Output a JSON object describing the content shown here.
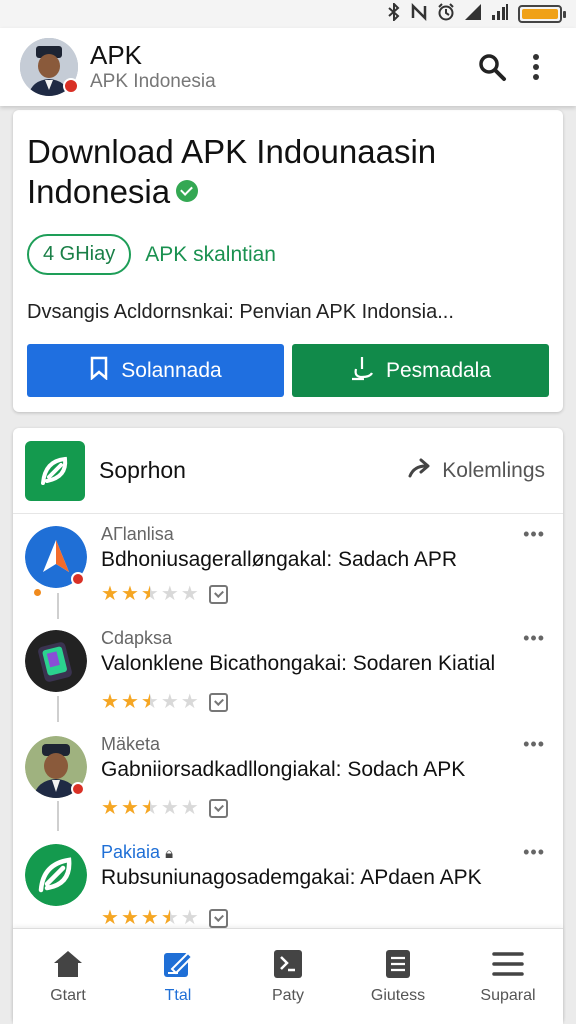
{
  "status_bar": {
    "icons": [
      "bluetooth-icon",
      "mute-icon",
      "alarm-icon",
      "signal-icon",
      "signal-bars-icon",
      "battery-icon"
    ],
    "battery_color": "#f0a117"
  },
  "app_bar": {
    "title": "APK",
    "subtitle": "APK Indonesia",
    "actions": [
      "search-icon",
      "more-vert-icon"
    ]
  },
  "hero": {
    "title": "Download APK Indounaasin Indonesia",
    "tag_pill": "4 GHiay",
    "tag_text": "APK skalntian",
    "description": "Dvsangis Acldornsnkai: Penvian APK Indonsia...",
    "primary_button": "Solannada",
    "secondary_button": "Pesmadala",
    "colors": {
      "primary": "#1f6fe0",
      "secondary": "#118a4a",
      "verified": "#34a853"
    }
  },
  "list": {
    "title": "Soprhon",
    "link": "Kolemlings",
    "items": [
      {
        "category": "AГlanlisa",
        "name": "Bdhoniusageralløngakal: Sadach APR",
        "rating": 2.5,
        "icon": "arrow-app-icon"
      },
      {
        "category": "Cdapksa",
        "name": "Valonklene Bicathongakai: Sodaren Kiatial",
        "rating": 2.5,
        "icon": "phone-app-icon"
      },
      {
        "category": "Mäketa",
        "name": "Gabniiorsadkadllongiakal: Sodach APK",
        "rating": 2.5,
        "icon": "person-app-icon"
      },
      {
        "category": "Pakiaia",
        "name": "Rubsuniunagosademgakai: APdaen APK",
        "rating": 3.5,
        "icon": "leaf-app-icon"
      }
    ]
  },
  "bottom_nav": {
    "items": [
      {
        "label": "Gtart",
        "icon": "home-icon"
      },
      {
        "label": "Ttal",
        "icon": "edit-icon"
      },
      {
        "label": "Paty",
        "icon": "terminal-icon"
      },
      {
        "label": "Giutess",
        "icon": "document-icon"
      },
      {
        "label": "Suparal",
        "icon": "menu-icon"
      }
    ],
    "active_index": 1
  }
}
